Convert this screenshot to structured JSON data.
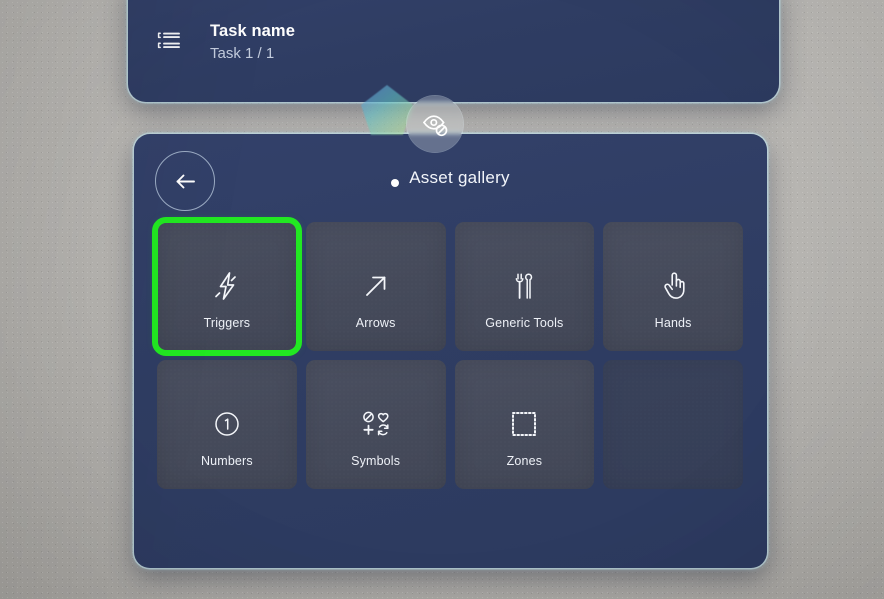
{
  "task_card": {
    "icon": "task-list-icon",
    "title": "Task name",
    "subtitle": "Task 1 / 1"
  },
  "handles": {
    "diamond": "gradient-diamond-handle",
    "hide_toggle_icon": "eye-hide-icon"
  },
  "gallery": {
    "back_icon": "arrow-left-icon",
    "title": "Asset gallery",
    "title_dot": "status-dot",
    "tiles": [
      {
        "label": "Triggers",
        "icon": "lightning-bolt-icon",
        "selected": true,
        "empty": false
      },
      {
        "label": "Arrows",
        "icon": "arrow-up-right-icon",
        "selected": false,
        "empty": false
      },
      {
        "label": "Generic Tools",
        "icon": "tools-icon",
        "selected": false,
        "empty": false
      },
      {
        "label": "Hands",
        "icon": "pointing-hand-icon",
        "selected": false,
        "empty": false
      },
      {
        "label": "Numbers",
        "icon": "circled-one-icon",
        "selected": false,
        "empty": false
      },
      {
        "label": "Symbols",
        "icon": "symbols-grid-icon",
        "selected": false,
        "empty": false
      },
      {
        "label": "Zones",
        "icon": "dotted-square-icon",
        "selected": false,
        "empty": false
      },
      {
        "label": "",
        "icon": "",
        "selected": false,
        "empty": true
      }
    ]
  },
  "colors": {
    "panel_blue": "#2F3D63",
    "tile_grey": "#464B5C",
    "selection_green": "#22E822",
    "panel_glow": "#C6E8F0",
    "wall_grey": "#B5B3AF",
    "text_primary": "#FFFFFF",
    "text_secondary": "#C3CCDD"
  }
}
